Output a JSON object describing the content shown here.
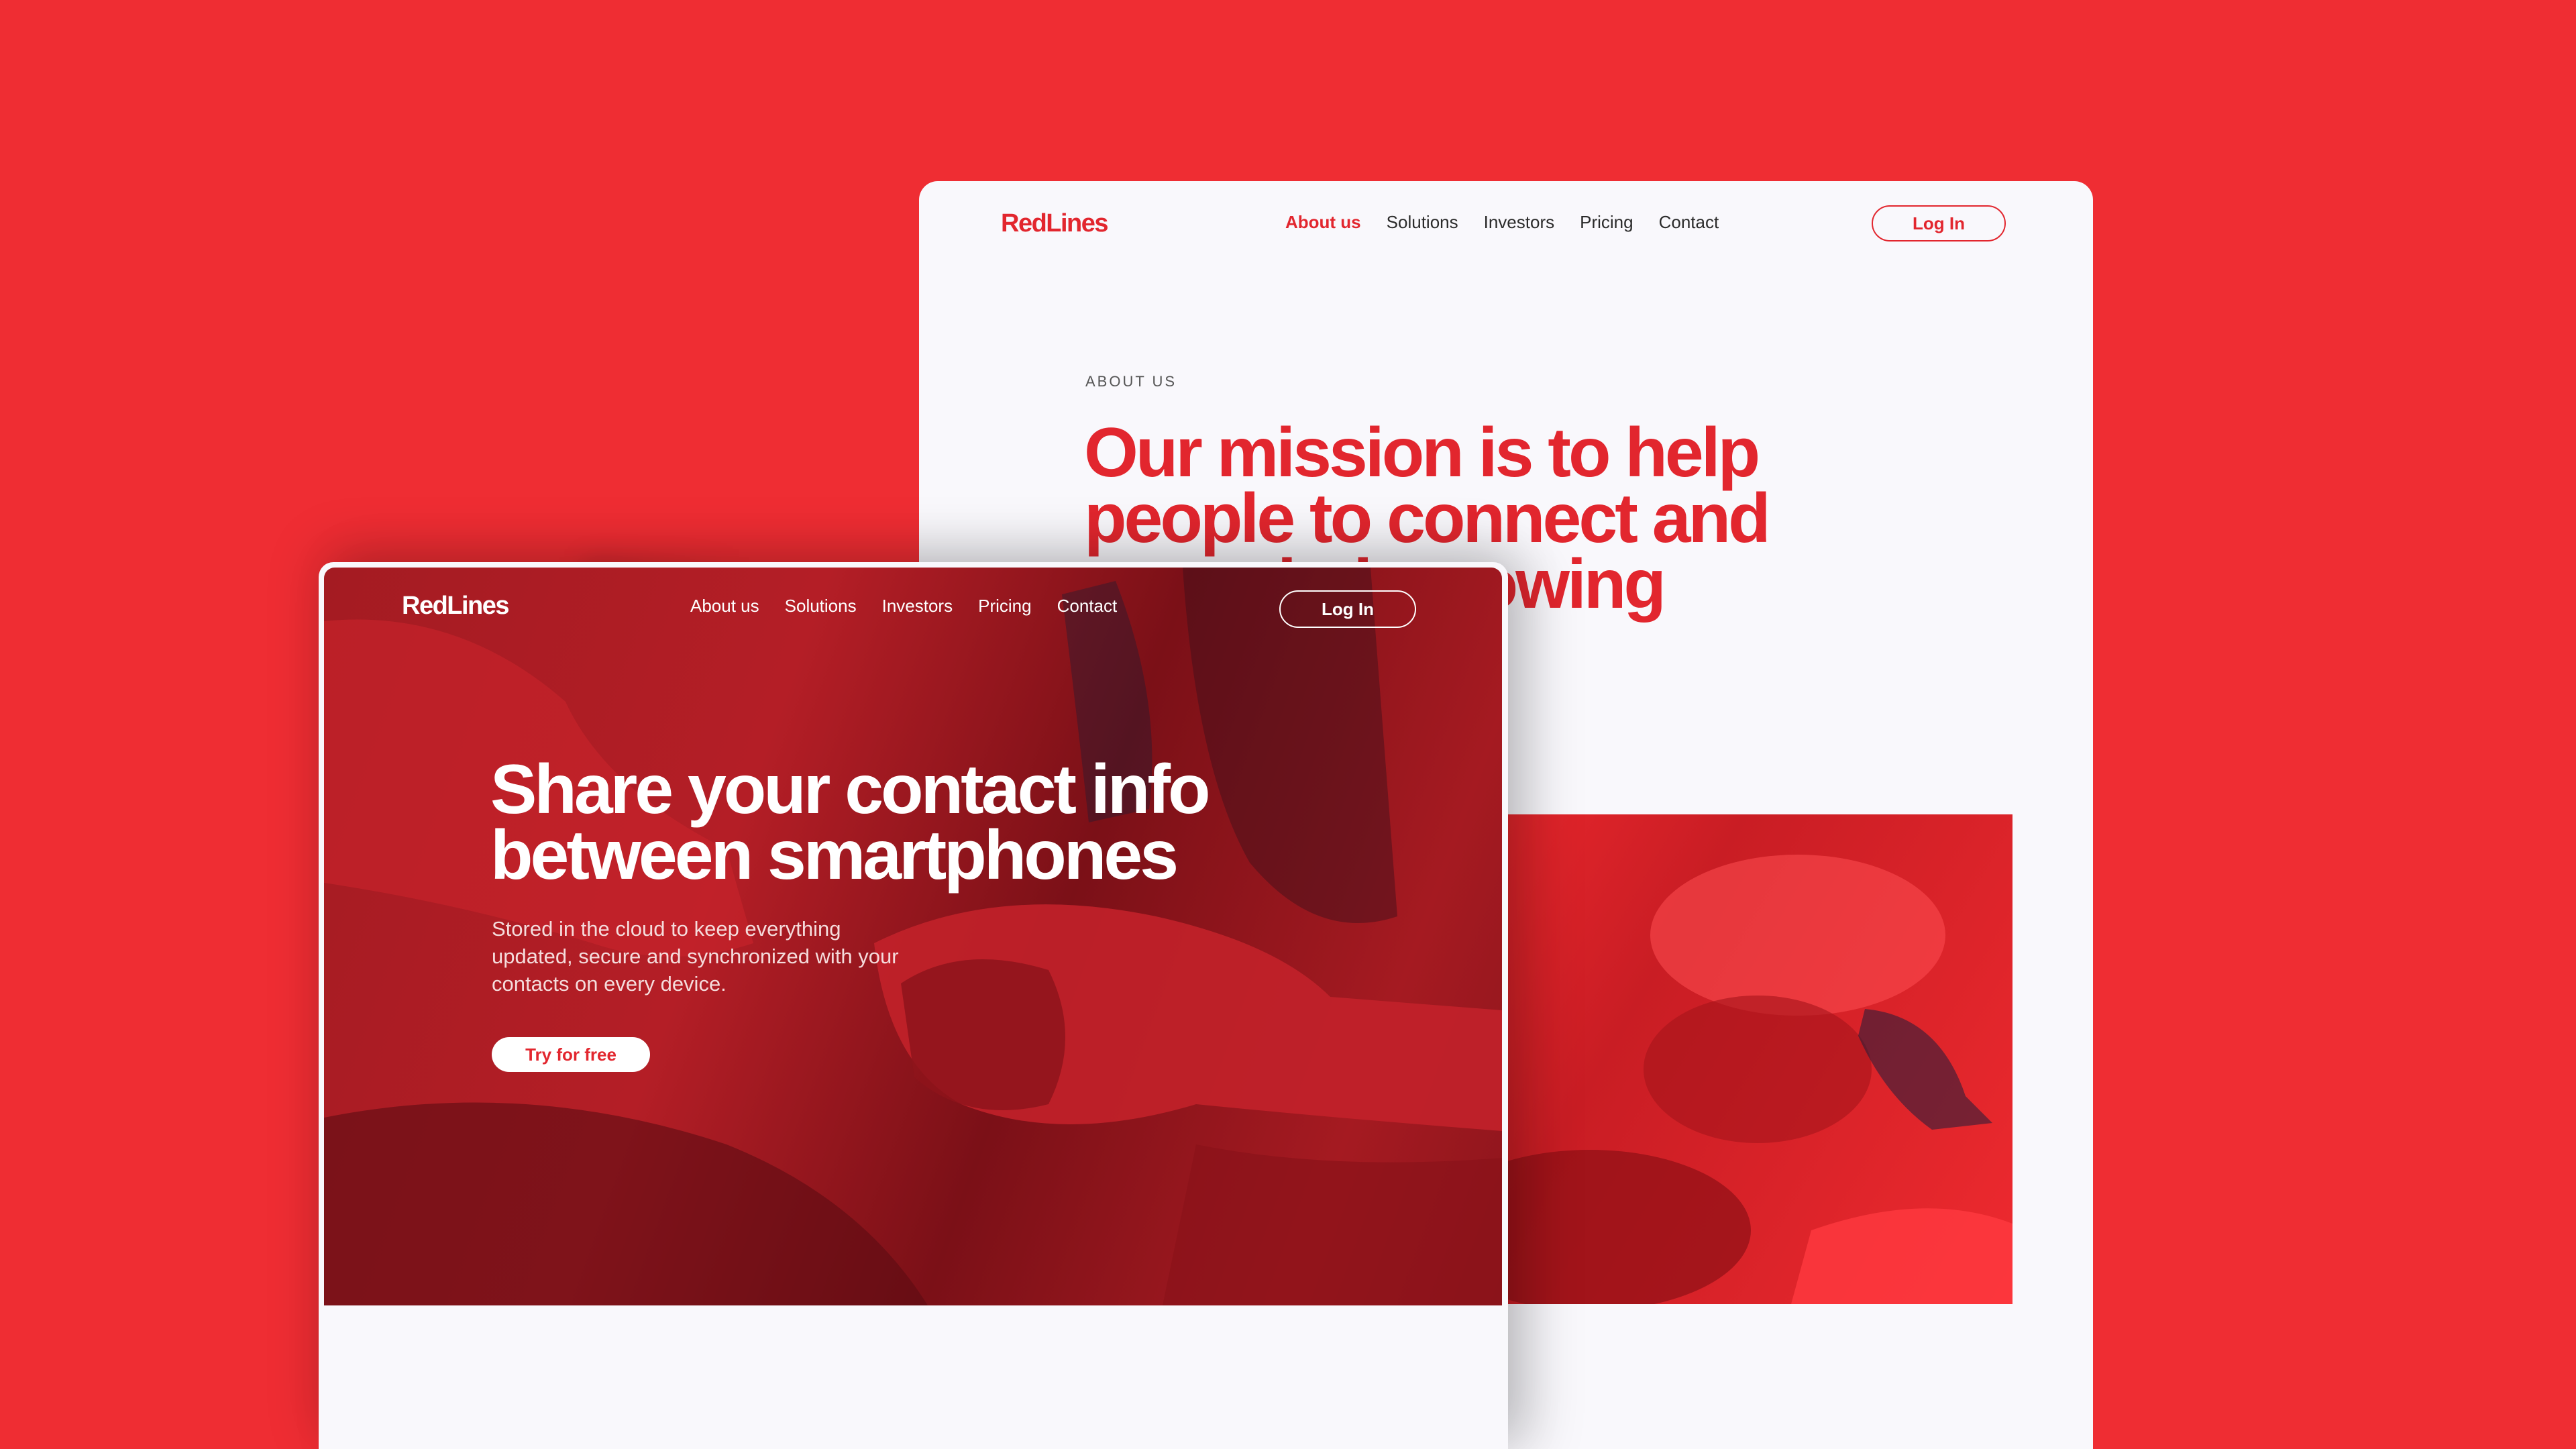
{
  "colors": {
    "background": "#EF2D33",
    "brand_red": "#E2262E",
    "page_bg": "#F9F8FC"
  },
  "back_page": {
    "logo": "RedLines",
    "nav": [
      "About us",
      "Solutions",
      "Investors",
      "Pricing",
      "Contact"
    ],
    "active_nav": "About us",
    "login_label": "Log In",
    "eyebrow": "ABOUT US",
    "mission": "Our mission is to help people to connect and grow their growing business"
  },
  "front_page": {
    "logo": "RedLines",
    "nav": [
      "About us",
      "Solutions",
      "Investors",
      "Pricing",
      "Contact"
    ],
    "login_label": "Log In",
    "hero_title": "Share your contact info between smartphones",
    "hero_subtitle": "Stored in the cloud to keep everything updated, secure and synchronized with your contacts on every device.",
    "cta_label": "Try for free"
  }
}
